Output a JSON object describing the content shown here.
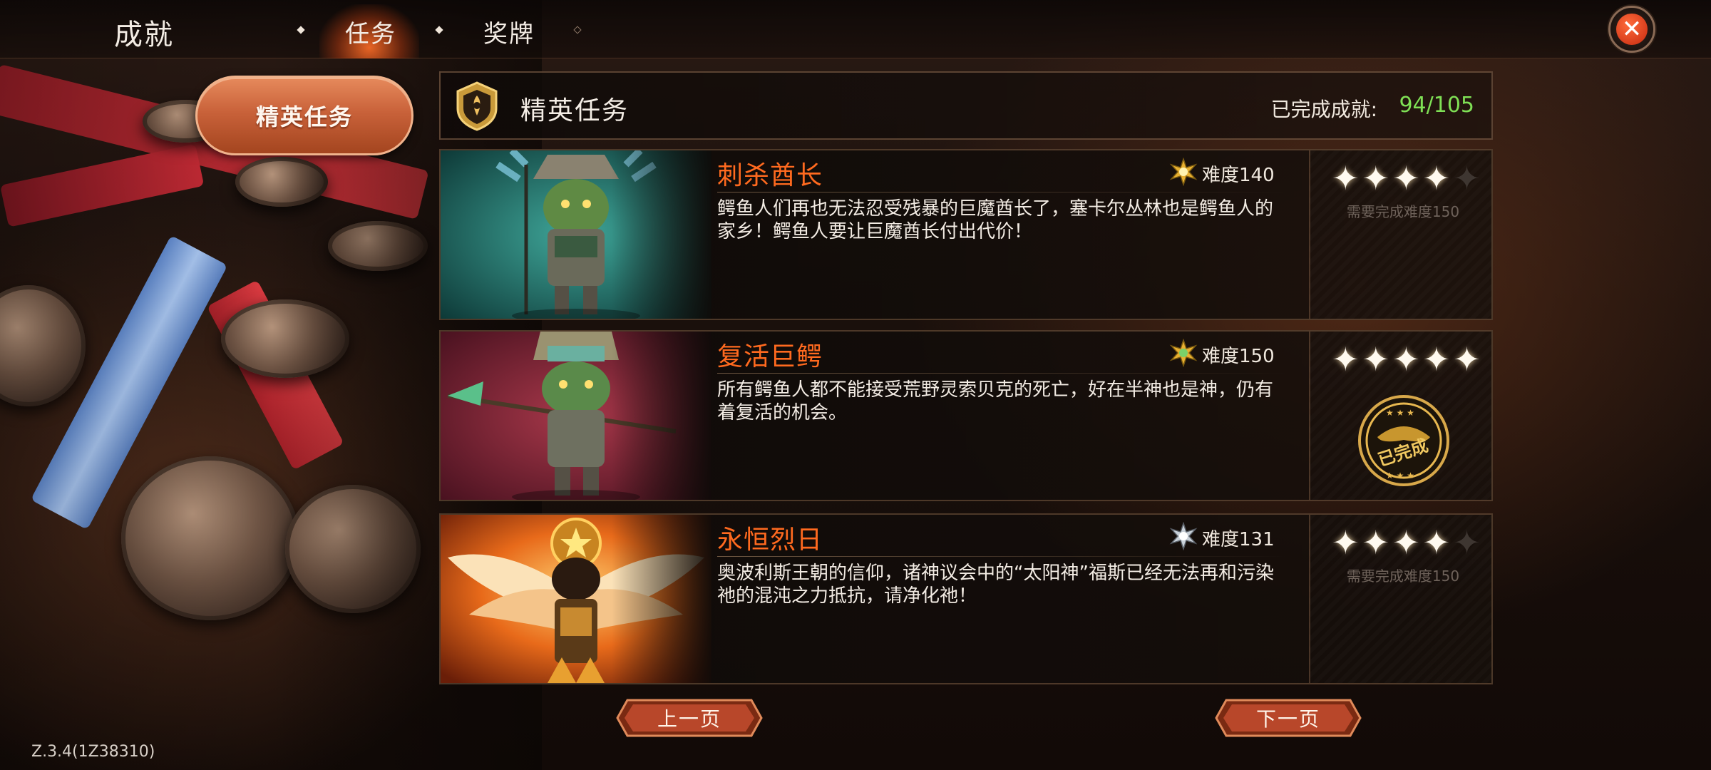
{
  "header": {
    "title": "成就",
    "tabs": [
      {
        "label": "任务",
        "active": true
      },
      {
        "label": "奖牌",
        "active": false
      }
    ],
    "close_icon": "close-icon"
  },
  "sidebar": {
    "category": "精英任务"
  },
  "panel": {
    "title": "精英任务",
    "completed_label": "已完成成就:",
    "completed_value": "94/105"
  },
  "tasks": [
    {
      "name": "刺杀酋长",
      "difficulty": "难度140",
      "description": "鳄鱼人们再也无法忍受残暴的巨魔酋长了，塞卡尔丛林也是鳄鱼人的家乡！鳄鱼人要让巨魔酋长付出代价！",
      "stars": 4,
      "max_stars": 5,
      "requirement": "需要完成难度150",
      "completed": false,
      "theme": "teal"
    },
    {
      "name": "复活巨鳄",
      "difficulty": "难度150",
      "description": "所有鳄鱼人都不能接受荒野灵索贝克的死亡，好在半神也是神，仍有着复活的机会。",
      "stars": 5,
      "max_stars": 5,
      "stamp": "已完成",
      "completed": true,
      "theme": "crimson"
    },
    {
      "name": "永恒烈日",
      "difficulty": "难度131",
      "description": "奥波利斯王朝的信仰，诸神议会中的“太阳神”福斯已经无法再和污染祂的混沌之力抵抗，请净化祂！",
      "stars": 4,
      "max_stars": 5,
      "requirement": "需要完成难度150",
      "completed": false,
      "theme": "fire"
    }
  ],
  "pager": {
    "prev": "上一页",
    "next": "下一页"
  },
  "version": "Z.3.4(1Z38310)",
  "colors": {
    "accent_orange": "#ff6a1f",
    "completed_green": "#7fe055",
    "close_red": "#c62a10"
  }
}
